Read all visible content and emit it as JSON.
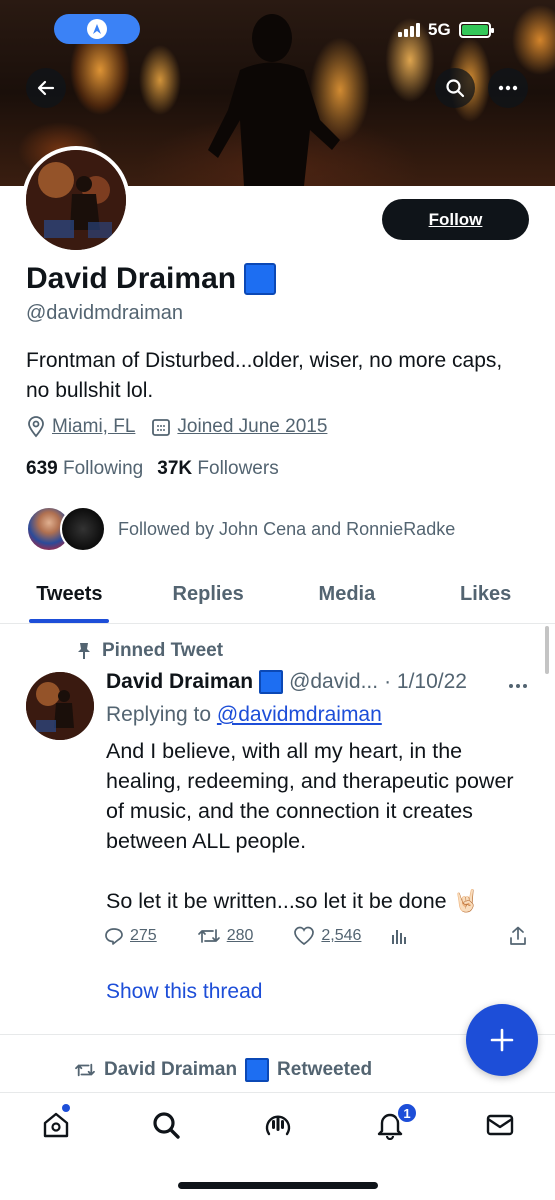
{
  "status_bar": {
    "network": "5G"
  },
  "profile": {
    "name": "David Draiman",
    "handle": "@davidmdraiman",
    "bio": "Frontman of Disturbed...older, wiser, no more caps, no bullshit lol.",
    "location": "Miami, FL",
    "joined": "Joined June 2015",
    "following_count": "639",
    "following_label": "Following",
    "followers_count": "37K",
    "followers_label": "Followers",
    "followed_by": "Followed by John Cena and RonnieRadke",
    "follow_button": "Follow"
  },
  "tabs": [
    {
      "label": "Tweets",
      "active": true
    },
    {
      "label": "Replies",
      "active": false
    },
    {
      "label": "Media",
      "active": false
    },
    {
      "label": "Likes",
      "active": false
    }
  ],
  "pinned_tweet": {
    "pinned_label": "Pinned Tweet",
    "author_name": "David Draiman",
    "author_handle": "@david...",
    "date": "· 1/10/22",
    "replying_prefix": "Replying to",
    "replying_to": "@davidmdraiman",
    "body_p1": "And I believe, with all my heart, in the healing, redeeming, and therapeutic power of music, and the connection it creates between ALL people.",
    "body_p2": "So let it be written...so let it be done 🤘🏻",
    "replies": "275",
    "retweets": "280",
    "likes": "2,546",
    "show_thread": "Show this thread"
  },
  "next_item": {
    "retweeted_name": "David Draiman",
    "retweeted_label": "Retweeted"
  },
  "bottom_nav": {
    "notification_badge": "1"
  },
  "colors": {
    "accent": "#1d4ed8",
    "text": "#0f1419",
    "muted": "#536471"
  }
}
